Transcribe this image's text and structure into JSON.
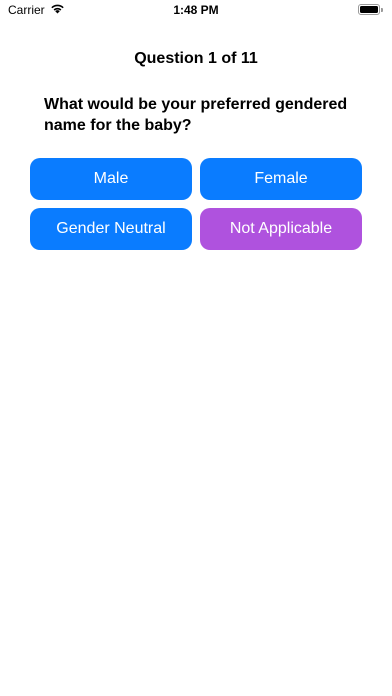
{
  "status_bar": {
    "carrier": "Carrier",
    "time": "1:48 PM",
    "wifi_icon": "wifi-icon",
    "battery_icon": "battery-icon",
    "battery_level": 1.0
  },
  "quiz": {
    "counter": "Question 1 of 11",
    "question": "What would be your preferred gendered name for the baby?",
    "answers": [
      {
        "label": "Male",
        "color": "#0a7cff"
      },
      {
        "label": "Female",
        "color": "#0a7cff"
      },
      {
        "label": "Gender Neutral",
        "color": "#0a7cff"
      },
      {
        "label": "Not Applicable",
        "color": "#af52de"
      }
    ]
  }
}
